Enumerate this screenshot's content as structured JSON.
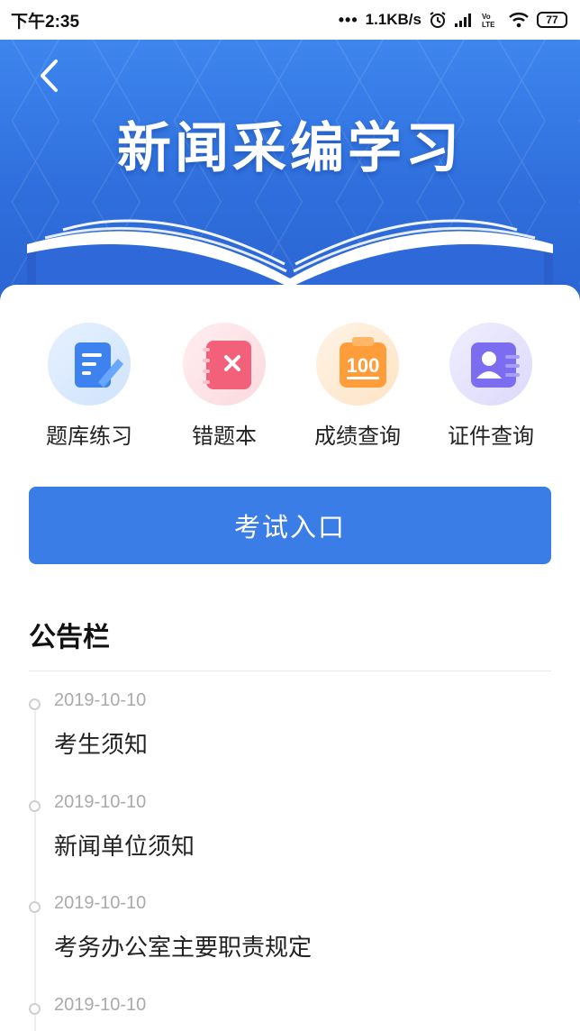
{
  "status_bar": {
    "time": "下午2:35",
    "dots": "•••",
    "speed": "1.1KB/s",
    "network": "Vo LTE",
    "battery": "77"
  },
  "banner": {
    "title": "新闻采编学习"
  },
  "quick_actions": [
    {
      "label": "题库练习",
      "icon": "document-edit-icon"
    },
    {
      "label": "错题本",
      "icon": "notebook-x-icon"
    },
    {
      "label": "成绩查询",
      "icon": "score-100-icon"
    },
    {
      "label": "证件查询",
      "icon": "id-card-icon"
    }
  ],
  "exam_button": {
    "label": "考试入口"
  },
  "notice_board": {
    "title": "公告栏",
    "items": [
      {
        "date": "2019-10-10",
        "title": "考生须知"
      },
      {
        "date": "2019-10-10",
        "title": "新闻单位须知"
      },
      {
        "date": "2019-10-10",
        "title": "考务办公室主要职责规定"
      },
      {
        "date": "2019-10-10",
        "title": ""
      }
    ]
  },
  "colors": {
    "primary": "#3b7de6",
    "banner_top": "#3e86ee",
    "banner_bottom": "#2a64d2"
  }
}
